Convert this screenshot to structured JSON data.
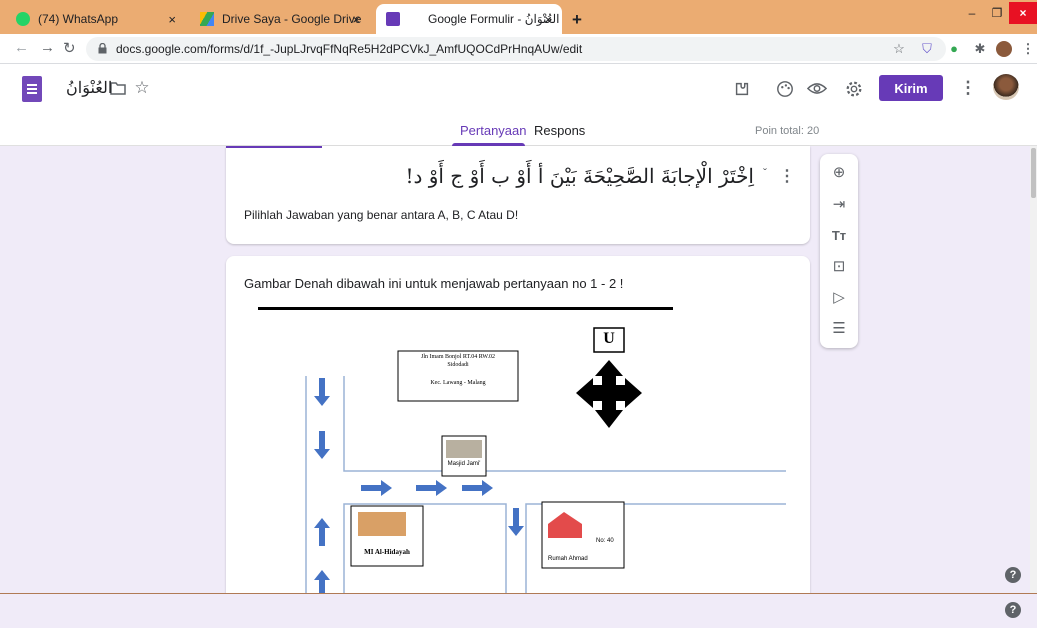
{
  "browser": {
    "tabs": [
      {
        "title": "(74) WhatsApp",
        "icon": "whatsapp-icon"
      },
      {
        "title": "Drive Saya - Google Drive",
        "icon": "google-drive-icon"
      },
      {
        "title": "Google Formulir - العُنْوَانُ",
        "icon": "google-forms-icon"
      }
    ],
    "new_tab": "+",
    "close": "×",
    "minimize": "–",
    "restore": "❐",
    "window_close": "×",
    "url": "docs.google.com/forms/d/1f_-JupLJrvqFfNqRe5H2dPCVkJ_AmfUQOCdPrHnqAUw/edit"
  },
  "header": {
    "form_title": "العُنْوَانُ",
    "send_label": "Kirim",
    "tabs": [
      "Pertanyaan",
      "Respons"
    ],
    "points_total": "Poin total: 20"
  },
  "question": {
    "title": "اِخْتَرْ الْإجابَةَ الصَّحِيْحَةَ بَيْنَ أ أَوْ ب أَوْ ج أَوْ د!",
    "description": "Pilihlah Jawaban yang benar antara A, B, C Atau D!"
  },
  "section": {
    "title": "Gambar Denah dibawah ini untuk menjawab pertanyaan no 1 - 2 !"
  },
  "map": {
    "north_label": "U",
    "address_line1": "Jln Imam Bonjol  RT.04 RW.02",
    "address_line2": "Sidodadi",
    "address_line3": "Kec. Lawang - Malang",
    "mosque_label": "Masjid Jami'",
    "school_label": "MI Al-Hidayah",
    "house_number": "No: 40",
    "house_label": "Rumah Ahmad"
  },
  "help": "?",
  "colors": {
    "accent": "#673ab7",
    "tabstrip": "#ebac72",
    "background": "#f0ebf8",
    "arrow": "#4472c4"
  }
}
